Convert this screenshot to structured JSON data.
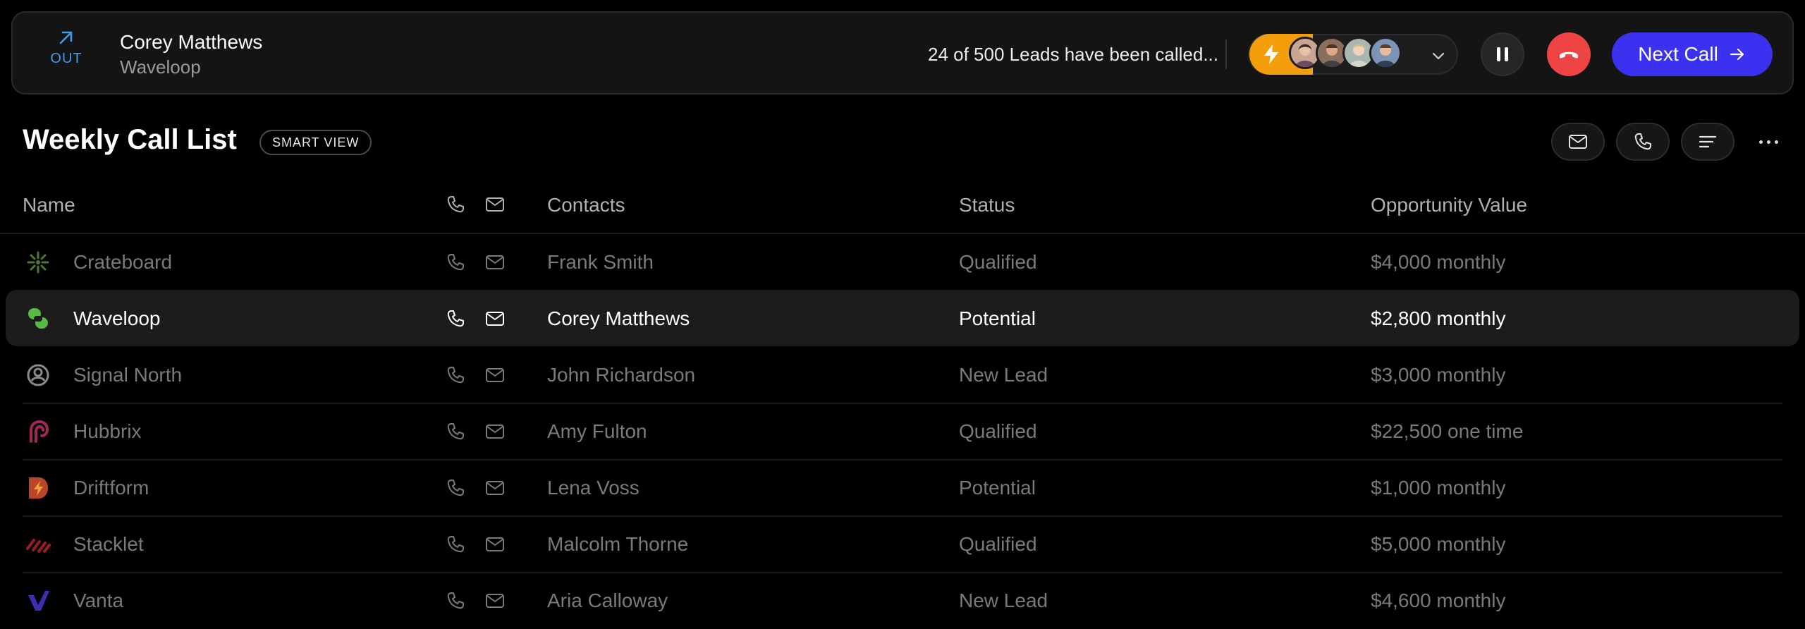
{
  "call": {
    "direction": "OUT",
    "caller_name": "Corey Matthews",
    "caller_company": "Waveloop",
    "progress_text": "24 of 500 Leads have been called...",
    "next_label": "Next Call"
  },
  "list": {
    "title": "Weekly Call List",
    "badge": "SMART VIEW"
  },
  "table": {
    "headers": {
      "name": "Name",
      "contacts": "Contacts",
      "status": "Status",
      "value": "Opportunity Value"
    },
    "rows": [
      {
        "name": "Crateboard",
        "contact": "Frank Smith",
        "status": "Qualified",
        "value": "$4,000 monthly",
        "logo": "crateboard-logo",
        "logo_color": "#4d7a2a"
      },
      {
        "name": "Waveloop",
        "contact": "Corey Matthews",
        "status": "Potential",
        "value": "$2,800 monthly",
        "logo": "waveloop-logo",
        "logo_color": "#5ab846"
      },
      {
        "name": "Signal North",
        "contact": "John Richardson",
        "status": "New Lead",
        "value": "$3,000 monthly",
        "logo": "signal-north-logo",
        "logo_color": "#8a8a8a"
      },
      {
        "name": "Hubbrix",
        "contact": "Amy Fulton",
        "status": "Qualified",
        "value": "$22,500 one time",
        "logo": "hubbrix-logo",
        "logo_color": "#a3265a"
      },
      {
        "name": "Driftform",
        "contact": "Lena Voss",
        "status": "Potential",
        "value": "$1,000 monthly",
        "logo": "driftform-logo",
        "logo_color": "#b8452c"
      },
      {
        "name": "Stacklet",
        "contact": "Malcolm Thorne",
        "status": "Qualified",
        "value": "$5,000 monthly",
        "logo": "stacklet-logo",
        "logo_color": "#9c1c24"
      },
      {
        "name": "Vanta",
        "contact": "Aria Calloway",
        "status": "New Lead",
        "value": "$4,600 monthly",
        "logo": "vanta-logo",
        "logo_color": "#3b2fb0"
      }
    ],
    "active_row": 1
  },
  "colors": {
    "background": "#000000",
    "accent": "#3a32f0",
    "hangup": "#ef4444",
    "power": "#f59e0b",
    "outbound": "#3f9cf0"
  }
}
